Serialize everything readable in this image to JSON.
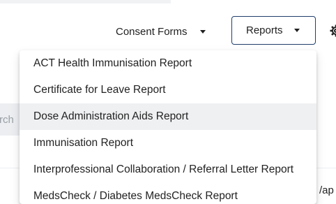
{
  "toolbar": {
    "consent_forms_label": "Consent Forms",
    "reports_label": "Reports"
  },
  "search": {
    "partial_text": "rch"
  },
  "reports_menu": {
    "items": [
      {
        "label": "ACT Health Immunisation Report"
      },
      {
        "label": "Certificate for Leave Report"
      },
      {
        "label": "Dose Administration Aids Report",
        "highlighted": true
      },
      {
        "label": "Immunisation Report"
      },
      {
        "label": "Interprofessional Collaboration / Referral Letter Report"
      },
      {
        "label": "MedsCheck / Diabetes MedsCheck Report"
      }
    ]
  },
  "background": {
    "right_partial_text": "/ap"
  },
  "colors": {
    "accent_border": "#1f3e6b",
    "highlight_background": "#eff0f2",
    "search_background": "#eceef1"
  },
  "icons": {
    "settings": "gear-icon"
  }
}
